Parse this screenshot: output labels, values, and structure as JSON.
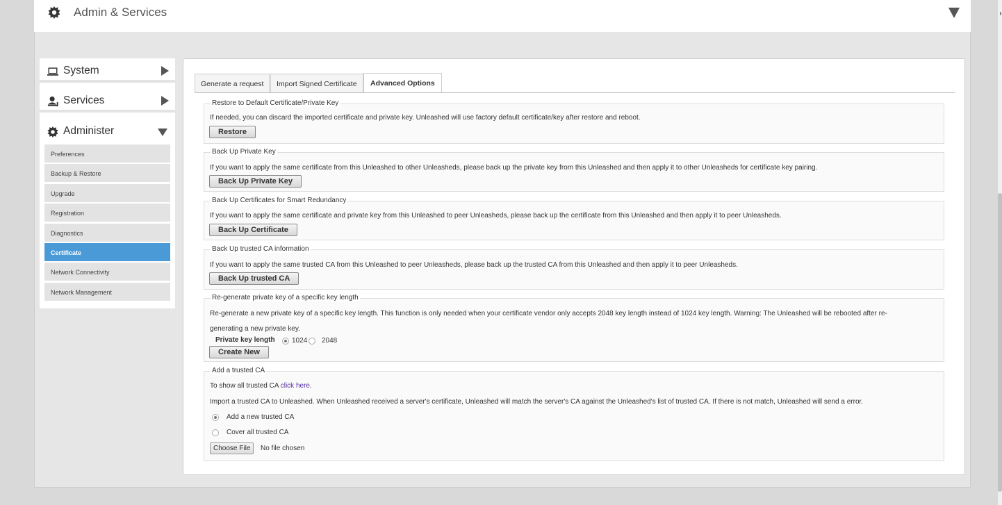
{
  "header": {
    "title": "Admin & Services"
  },
  "sidebar": {
    "sections": [
      {
        "label": "System",
        "icon": "laptop-icon"
      },
      {
        "label": "Services",
        "icon": "services-icon"
      },
      {
        "label": "Administer",
        "icon": "gear-icon"
      }
    ],
    "items": [
      {
        "label": "Preferences"
      },
      {
        "label": "Backup & Restore"
      },
      {
        "label": "Upgrade"
      },
      {
        "label": "Registration"
      },
      {
        "label": "Diagnostics"
      },
      {
        "label": "Certificate",
        "active": true
      },
      {
        "label": "Network Connectivity"
      },
      {
        "label": "Network Management"
      }
    ]
  },
  "tabs": [
    {
      "label": "Generate a request"
    },
    {
      "label": "Import Signed Certificate"
    },
    {
      "label": "Advanced Options",
      "active": true
    }
  ],
  "groups": {
    "restore": {
      "legend": "Restore to Default Certificate/Private Key",
      "desc": "If needed, you can discard the imported certificate and private key. Unleashed will use factory default certificate/key after restore and reboot.",
      "button": "Restore"
    },
    "backup_key": {
      "legend": "Back Up Private Key",
      "desc": "If you want to apply the same certificate from this Unleashed to other Unleasheds, please back up the private key from this Unleashed and then apply it to other Unleasheds for certificate key pairing.",
      "button": "Back Up Private Key"
    },
    "backup_cert": {
      "legend": "Back Up Certificates for Smart Redundancy",
      "desc": "If you want to apply the same certificate and private key from this Unleashed to peer Unleasheds, please back up the certificate from this Unleashed and then apply it to peer Unleasheds.",
      "button": "Back Up Certificate"
    },
    "backup_ca": {
      "legend": "Back Up trusted CA information",
      "desc": "If you want to apply the same trusted CA from this Unleashed to peer Unleasheds, please back up the trusted CA from this Unleashed and then apply it to peer Unleasheds.",
      "button": "Back Up trusted CA"
    },
    "regen": {
      "legend": "Re-generate private key of a specific key length",
      "desc1": "Re-generate a new private key of a specific key length. This function is only needed when your certificate vendor only accepts 2048 key length instead of 1024 key length. Warning: The Unleashed will be rebooted after re-",
      "desc2": "generating a new private key.",
      "key_length_label": "Private key length",
      "options": [
        "1024",
        "2048"
      ],
      "selected": "1024",
      "button": "Create New"
    },
    "add_ca": {
      "legend": "Add a trusted CA",
      "show_text": "To show all trusted CA",
      "show_link": "click here.",
      "desc": "Import a trusted CA to Unleashed. When Unleashed received a server's certificate, Unleashed will match the server's CA against the Unleashed's list of trusted CA. If there is not match, Unleashed will send a error.",
      "options": [
        "Add a new trusted CA",
        "Cover all trusted CA"
      ],
      "selected": "Add a new trusted CA",
      "file_button": "Choose File",
      "file_status": "No file chosen"
    }
  }
}
